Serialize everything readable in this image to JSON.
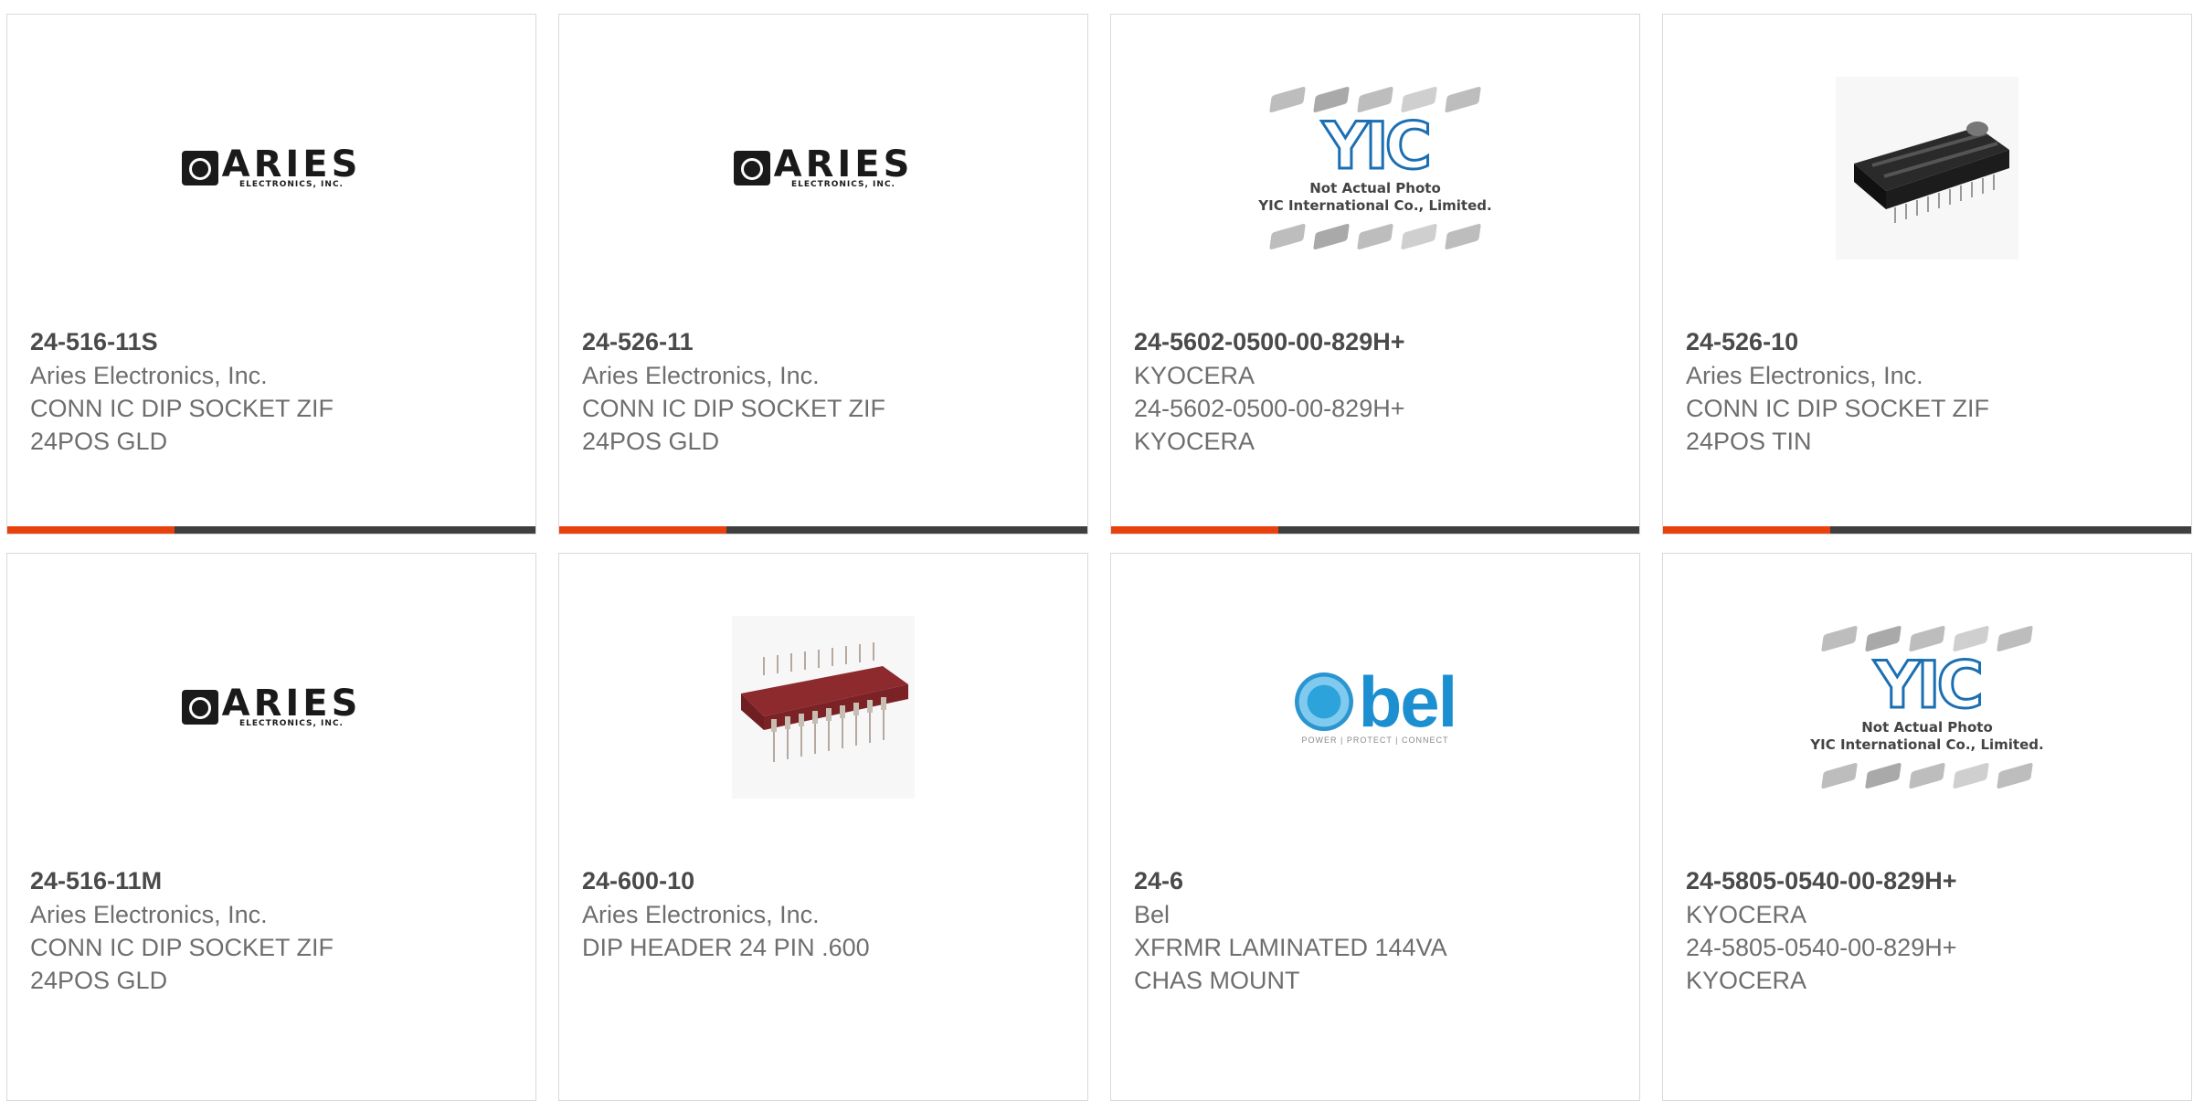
{
  "colors": {
    "accent": "#e8410e",
    "bar": "#3f3f3f",
    "border": "#d9d9d9"
  },
  "aries_logo": {
    "name": "ARIES",
    "sub": "ELECTRONICS, INC."
  },
  "yic_logo": {
    "mark": "YIC",
    "line1": "Not Actual Photo",
    "line2": "YIC International Co., Limited."
  },
  "bel_logo": {
    "name": "bel",
    "tagline": "POWER | PROTECT | CONNECT"
  },
  "cards": [
    {
      "part": "24-516-11S",
      "mfr": "Aries Electronics, Inc.",
      "desc": "CONN IC DIP SOCKET ZIF\n24POS GLD",
      "image": "aries-logo"
    },
    {
      "part": "24-526-11",
      "mfr": "Aries Electronics, Inc.",
      "desc": "CONN IC DIP SOCKET ZIF\n24POS GLD",
      "image": "aries-logo"
    },
    {
      "part": "24-5602-0500-00-829H+",
      "mfr": "KYOCERA",
      "desc": "24-5602-0500-00-829H+\nKYOCERA",
      "image": "yic-placeholder"
    },
    {
      "part": "24-526-10",
      "mfr": "Aries Electronics, Inc.",
      "desc": "CONN IC DIP SOCKET ZIF\n24POS TIN",
      "image": "black-dip-socket-photo"
    },
    {
      "part": "24-516-11M",
      "mfr": "Aries Electronics, Inc.",
      "desc": "CONN IC DIP SOCKET ZIF\n24POS GLD",
      "image": "aries-logo"
    },
    {
      "part": "24-600-10",
      "mfr": "Aries Electronics, Inc.",
      "desc": "DIP HEADER 24 PIN .600",
      "image": "red-dip-header-photo"
    },
    {
      "part": "24-6",
      "mfr": "Bel",
      "desc": "XFRMR LAMINATED 144VA\nCHAS MOUNT",
      "image": "bel-logo"
    },
    {
      "part": "24-5805-0540-00-829H+",
      "mfr": "KYOCERA",
      "desc": "24-5805-0540-00-829H+\nKYOCERA",
      "image": "yic-placeholder"
    }
  ]
}
